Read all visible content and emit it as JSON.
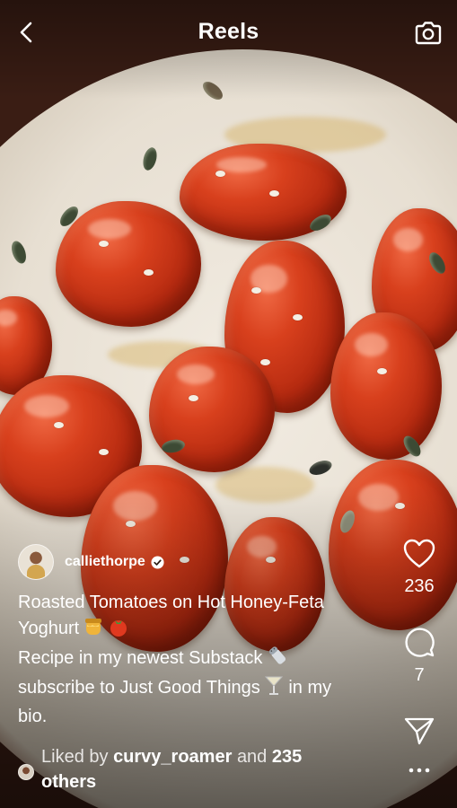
{
  "header": {
    "title": "Reels"
  },
  "post": {
    "username": "calliethorpe",
    "caption_line1": "Roasted Tomatoes on Hot Honey-Feta Yoghurt",
    "caption_line2": "Recipe in my newest Substack",
    "caption_line3": "subscribe to Just Good Things",
    "caption_line4": "in my bio.",
    "emoji_1": "honey-pot",
    "emoji_2": "tomato",
    "emoji_3": "salt-shaker",
    "emoji_4": "cocktail-glass"
  },
  "actions": {
    "like_count": "236",
    "comment_count": "7"
  },
  "likes": {
    "prefix": "Liked by",
    "user": "curvy_roamer",
    "connector": "and",
    "others": "235 others"
  },
  "colors": {
    "text": "#ffffff",
    "tomato": "#c8321a",
    "yoghurt": "#ece5d8"
  }
}
